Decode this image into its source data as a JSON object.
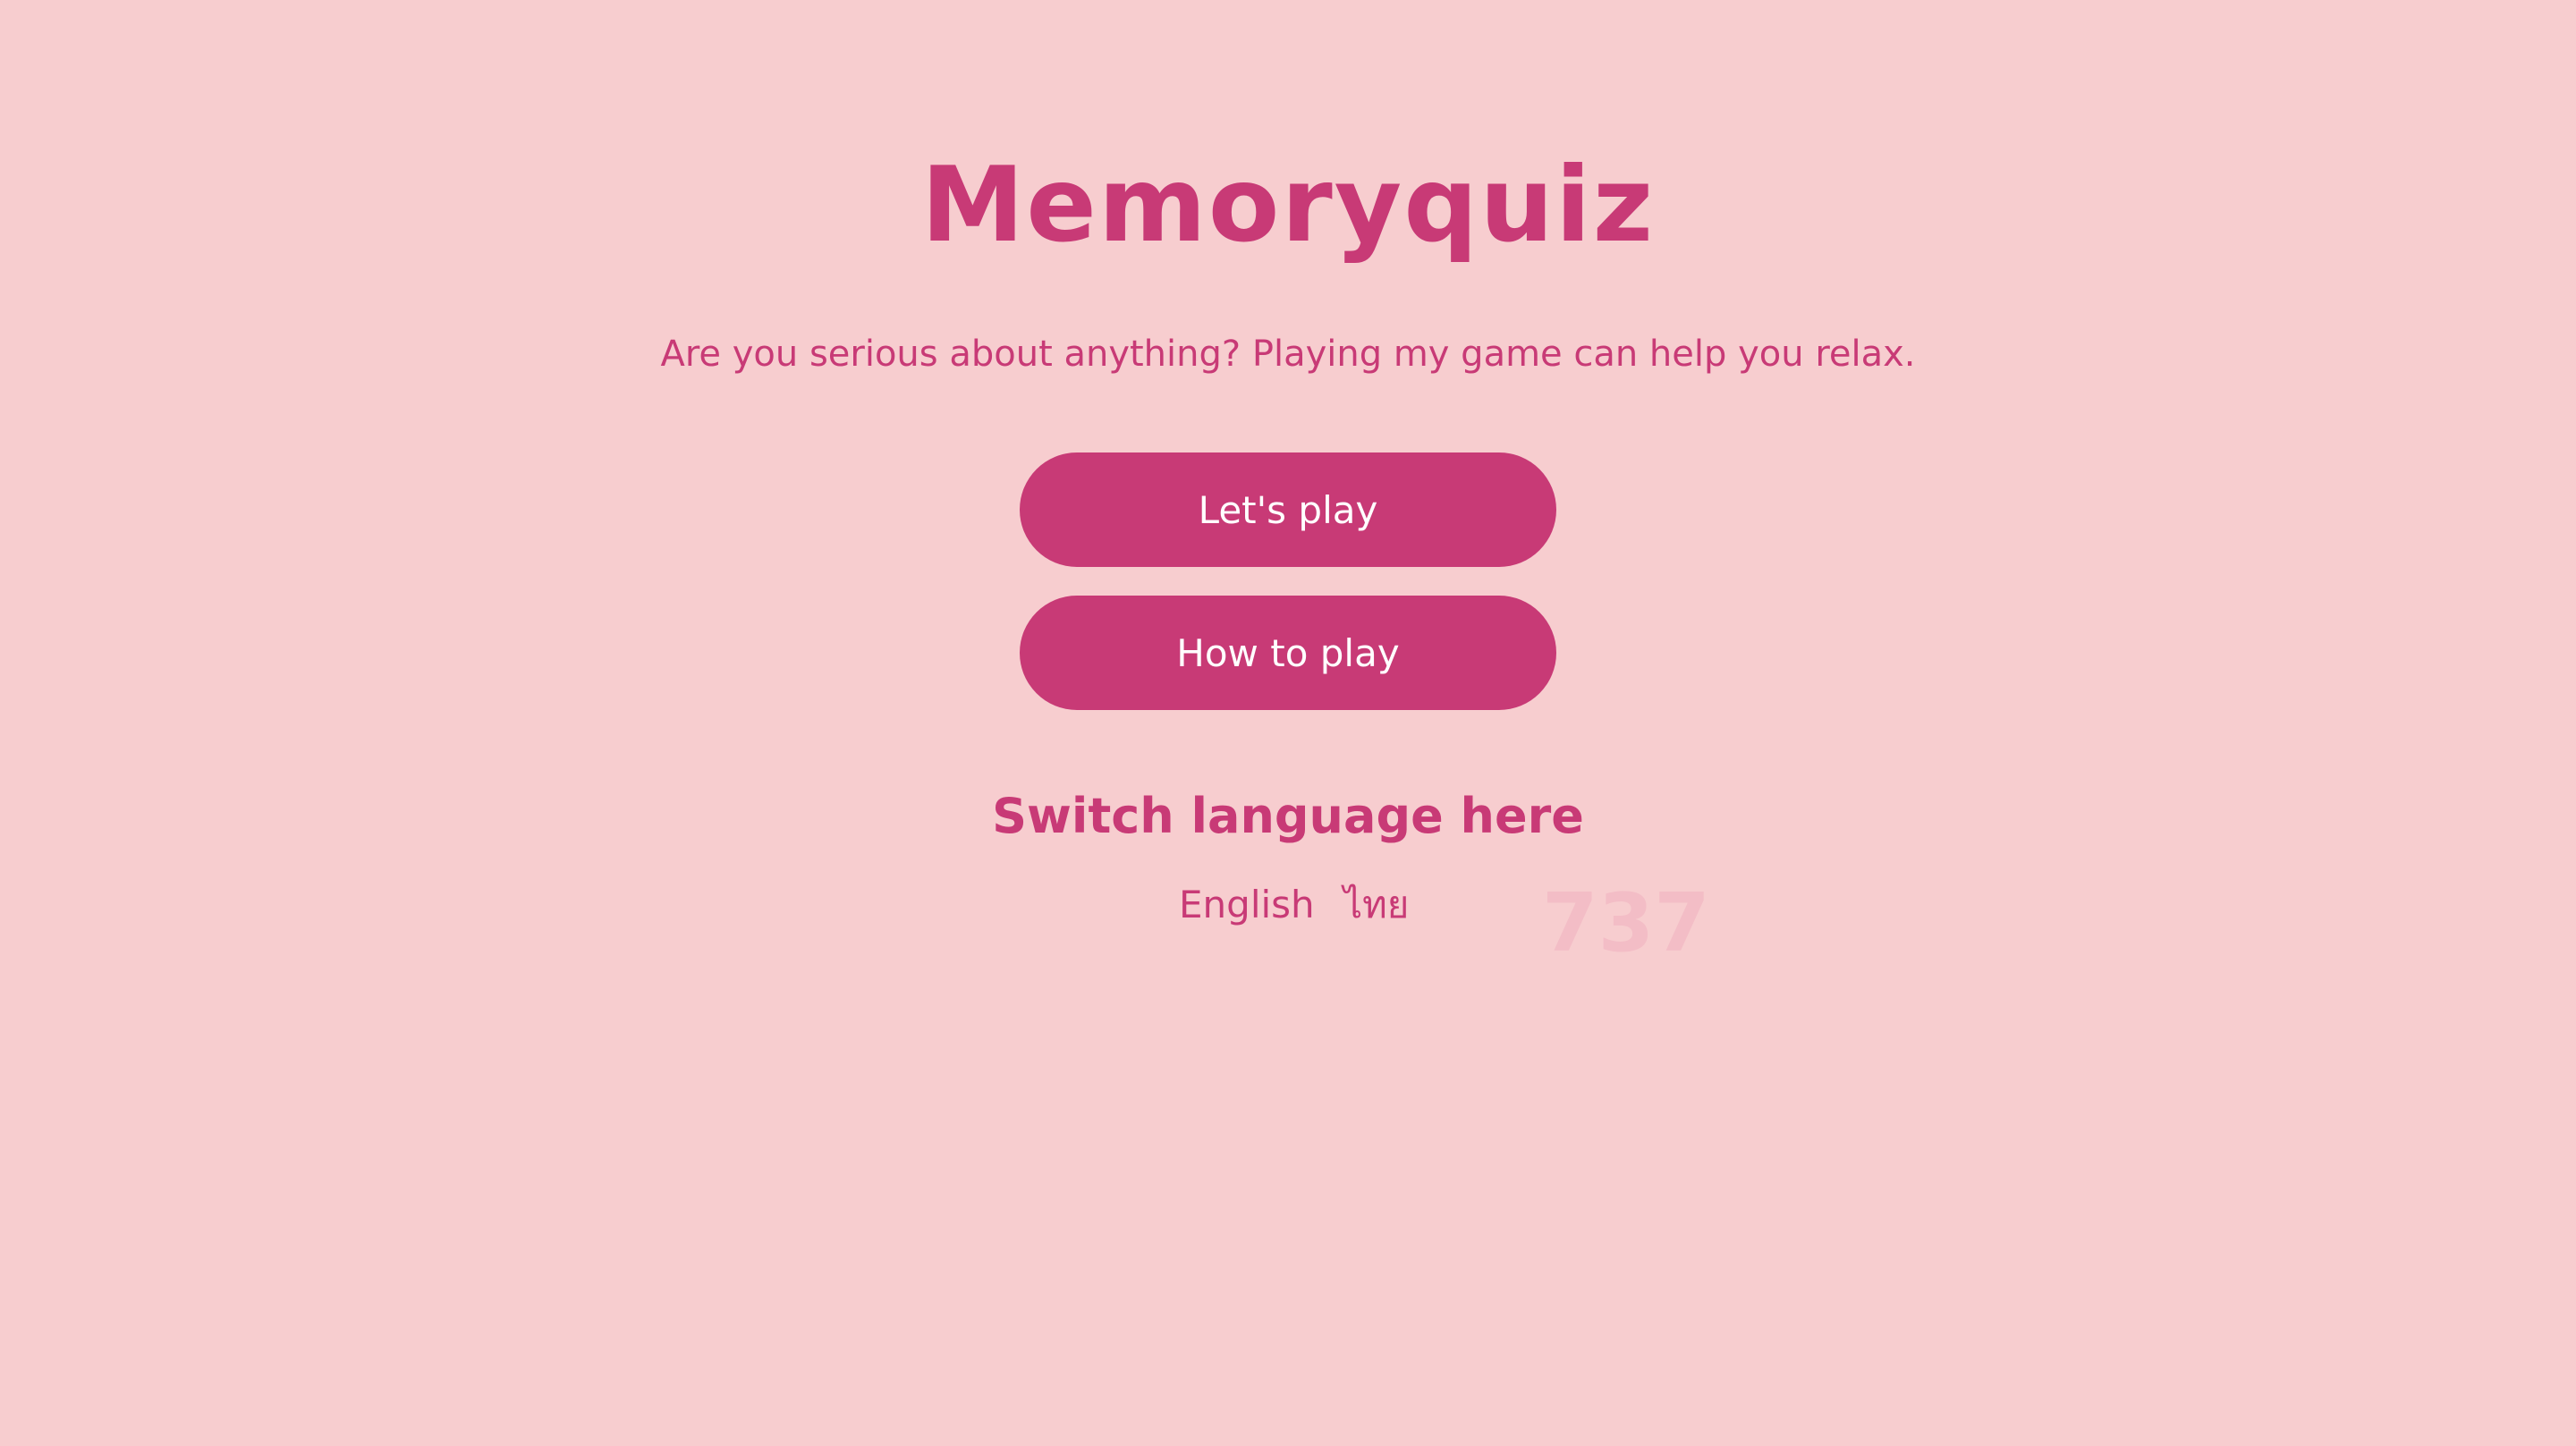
{
  "app": {
    "title": "Memoryquiz",
    "tagline": "Are you serious about anything? Playing my game can help you relax."
  },
  "menu": {
    "play_label": "Let's play",
    "how_label": "How to play"
  },
  "language": {
    "heading": "Switch language here",
    "options": [
      "English",
      "ไทย"
    ]
  },
  "watermark": {
    "text": "737"
  },
  "colors": {
    "background": "#f7cdcf",
    "accent": "#c83a76",
    "button_text": "#ffffff"
  }
}
